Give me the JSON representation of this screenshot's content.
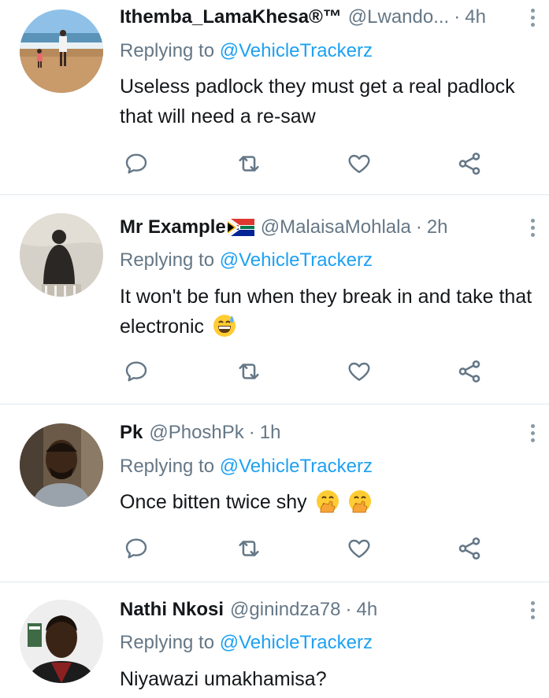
{
  "tweets": [
    {
      "name": "Ithemba_LamaKhesa®™",
      "handle": "@Lwando...",
      "time": "4h",
      "replying_prefix": "Replying to ",
      "replying_to": "@VehicleTrackerz",
      "text": "Useless padlock they must get a real padlock that will need a re-saw",
      "avatar": "beach-photo",
      "flag": null,
      "emojis": []
    },
    {
      "name": "Mr Example",
      "handle": "@MalaisaMohlala",
      "time": "2h",
      "replying_prefix": "Replying to ",
      "replying_to": "@VehicleTrackerz",
      "text": "It won't be fun when they break in and take that electronic",
      "avatar": "silhouette-photo",
      "flag": "south-africa-flag",
      "emojis": [
        "grinning-sweat-emoji"
      ]
    },
    {
      "name": "Pk",
      "handle": "@PhoshPk",
      "time": "1h",
      "replying_prefix": "Replying to ",
      "replying_to": "@VehicleTrackerz",
      "text": "Once bitten twice shy",
      "avatar": "portrait-photo",
      "flag": null,
      "emojis": [
        "hand-over-mouth-emoji",
        "hand-over-mouth-emoji"
      ]
    },
    {
      "name": "Nathi Nkosi",
      "handle": "@ginindza78",
      "time": "4h",
      "replying_prefix": "Replying to ",
      "replying_to": "@VehicleTrackerz",
      "text": "Niyawazi umakhamisa?",
      "avatar": "portrait-photo",
      "flag": null,
      "emojis": []
    }
  ],
  "icons": {
    "reply": "reply-icon",
    "retweet": "retweet-icon",
    "like": "heart-icon",
    "share": "share-icon",
    "more": "more-options-icon"
  },
  "colors": {
    "link": "#1da1f2",
    "secondary": "#657786",
    "icon": "#657786",
    "divider": "#e1e8ed"
  }
}
